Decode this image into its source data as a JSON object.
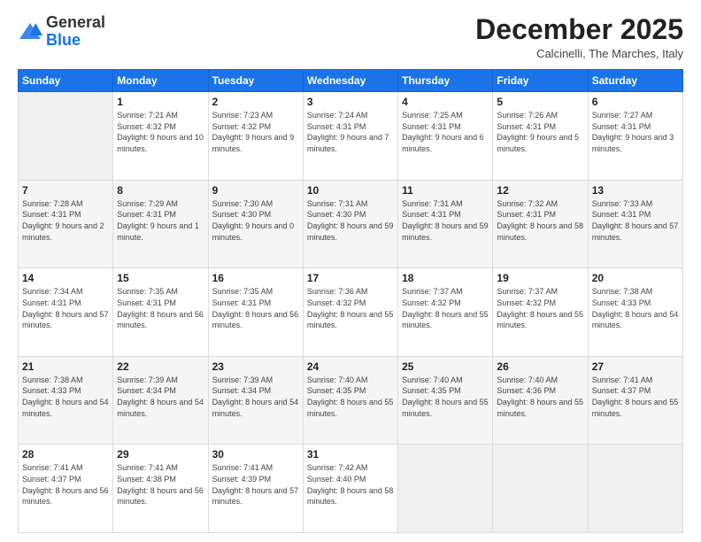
{
  "logo": {
    "general": "General",
    "blue": "Blue"
  },
  "header": {
    "month": "December 2025",
    "location": "Calcinelli, The Marches, Italy"
  },
  "weekdays": [
    "Sunday",
    "Monday",
    "Tuesday",
    "Wednesday",
    "Thursday",
    "Friday",
    "Saturday"
  ],
  "weeks": [
    [
      {
        "day": "",
        "empty": true
      },
      {
        "day": "1",
        "sunrise": "7:21 AM",
        "sunset": "4:32 PM",
        "daylight": "9 hours and 10 minutes."
      },
      {
        "day": "2",
        "sunrise": "7:23 AM",
        "sunset": "4:32 PM",
        "daylight": "9 hours and 9 minutes."
      },
      {
        "day": "3",
        "sunrise": "7:24 AM",
        "sunset": "4:31 PM",
        "daylight": "9 hours and 7 minutes."
      },
      {
        "day": "4",
        "sunrise": "7:25 AM",
        "sunset": "4:31 PM",
        "daylight": "9 hours and 6 minutes."
      },
      {
        "day": "5",
        "sunrise": "7:26 AM",
        "sunset": "4:31 PM",
        "daylight": "9 hours and 5 minutes."
      },
      {
        "day": "6",
        "sunrise": "7:27 AM",
        "sunset": "4:31 PM",
        "daylight": "9 hours and 3 minutes."
      }
    ],
    [
      {
        "day": "7",
        "sunrise": "7:28 AM",
        "sunset": "4:31 PM",
        "daylight": "9 hours and 2 minutes."
      },
      {
        "day": "8",
        "sunrise": "7:29 AM",
        "sunset": "4:31 PM",
        "daylight": "9 hours and 1 minute."
      },
      {
        "day": "9",
        "sunrise": "7:30 AM",
        "sunset": "4:30 PM",
        "daylight": "9 hours and 0 minutes."
      },
      {
        "day": "10",
        "sunrise": "7:31 AM",
        "sunset": "4:30 PM",
        "daylight": "8 hours and 59 minutes."
      },
      {
        "day": "11",
        "sunrise": "7:31 AM",
        "sunset": "4:31 PM",
        "daylight": "8 hours and 59 minutes."
      },
      {
        "day": "12",
        "sunrise": "7:32 AM",
        "sunset": "4:31 PM",
        "daylight": "8 hours and 58 minutes."
      },
      {
        "day": "13",
        "sunrise": "7:33 AM",
        "sunset": "4:31 PM",
        "daylight": "8 hours and 57 minutes."
      }
    ],
    [
      {
        "day": "14",
        "sunrise": "7:34 AM",
        "sunset": "4:31 PM",
        "daylight": "8 hours and 57 minutes."
      },
      {
        "day": "15",
        "sunrise": "7:35 AM",
        "sunset": "4:31 PM",
        "daylight": "8 hours and 56 minutes."
      },
      {
        "day": "16",
        "sunrise": "7:35 AM",
        "sunset": "4:31 PM",
        "daylight": "8 hours and 56 minutes."
      },
      {
        "day": "17",
        "sunrise": "7:36 AM",
        "sunset": "4:32 PM",
        "daylight": "8 hours and 55 minutes."
      },
      {
        "day": "18",
        "sunrise": "7:37 AM",
        "sunset": "4:32 PM",
        "daylight": "8 hours and 55 minutes."
      },
      {
        "day": "19",
        "sunrise": "7:37 AM",
        "sunset": "4:32 PM",
        "daylight": "8 hours and 55 minutes."
      },
      {
        "day": "20",
        "sunrise": "7:38 AM",
        "sunset": "4:33 PM",
        "daylight": "8 hours and 54 minutes."
      }
    ],
    [
      {
        "day": "21",
        "sunrise": "7:38 AM",
        "sunset": "4:33 PM",
        "daylight": "8 hours and 54 minutes."
      },
      {
        "day": "22",
        "sunrise": "7:39 AM",
        "sunset": "4:34 PM",
        "daylight": "8 hours and 54 minutes."
      },
      {
        "day": "23",
        "sunrise": "7:39 AM",
        "sunset": "4:34 PM",
        "daylight": "8 hours and 54 minutes."
      },
      {
        "day": "24",
        "sunrise": "7:40 AM",
        "sunset": "4:35 PM",
        "daylight": "8 hours and 55 minutes."
      },
      {
        "day": "25",
        "sunrise": "7:40 AM",
        "sunset": "4:35 PM",
        "daylight": "8 hours and 55 minutes."
      },
      {
        "day": "26",
        "sunrise": "7:40 AM",
        "sunset": "4:36 PM",
        "daylight": "8 hours and 55 minutes."
      },
      {
        "day": "27",
        "sunrise": "7:41 AM",
        "sunset": "4:37 PM",
        "daylight": "8 hours and 55 minutes."
      }
    ],
    [
      {
        "day": "28",
        "sunrise": "7:41 AM",
        "sunset": "4:37 PM",
        "daylight": "8 hours and 56 minutes."
      },
      {
        "day": "29",
        "sunrise": "7:41 AM",
        "sunset": "4:38 PM",
        "daylight": "8 hours and 56 minutes."
      },
      {
        "day": "30",
        "sunrise": "7:41 AM",
        "sunset": "4:39 PM",
        "daylight": "8 hours and 57 minutes."
      },
      {
        "day": "31",
        "sunrise": "7:42 AM",
        "sunset": "4:40 PM",
        "daylight": "8 hours and 58 minutes."
      },
      {
        "day": "",
        "empty": true
      },
      {
        "day": "",
        "empty": true
      },
      {
        "day": "",
        "empty": true
      }
    ]
  ]
}
